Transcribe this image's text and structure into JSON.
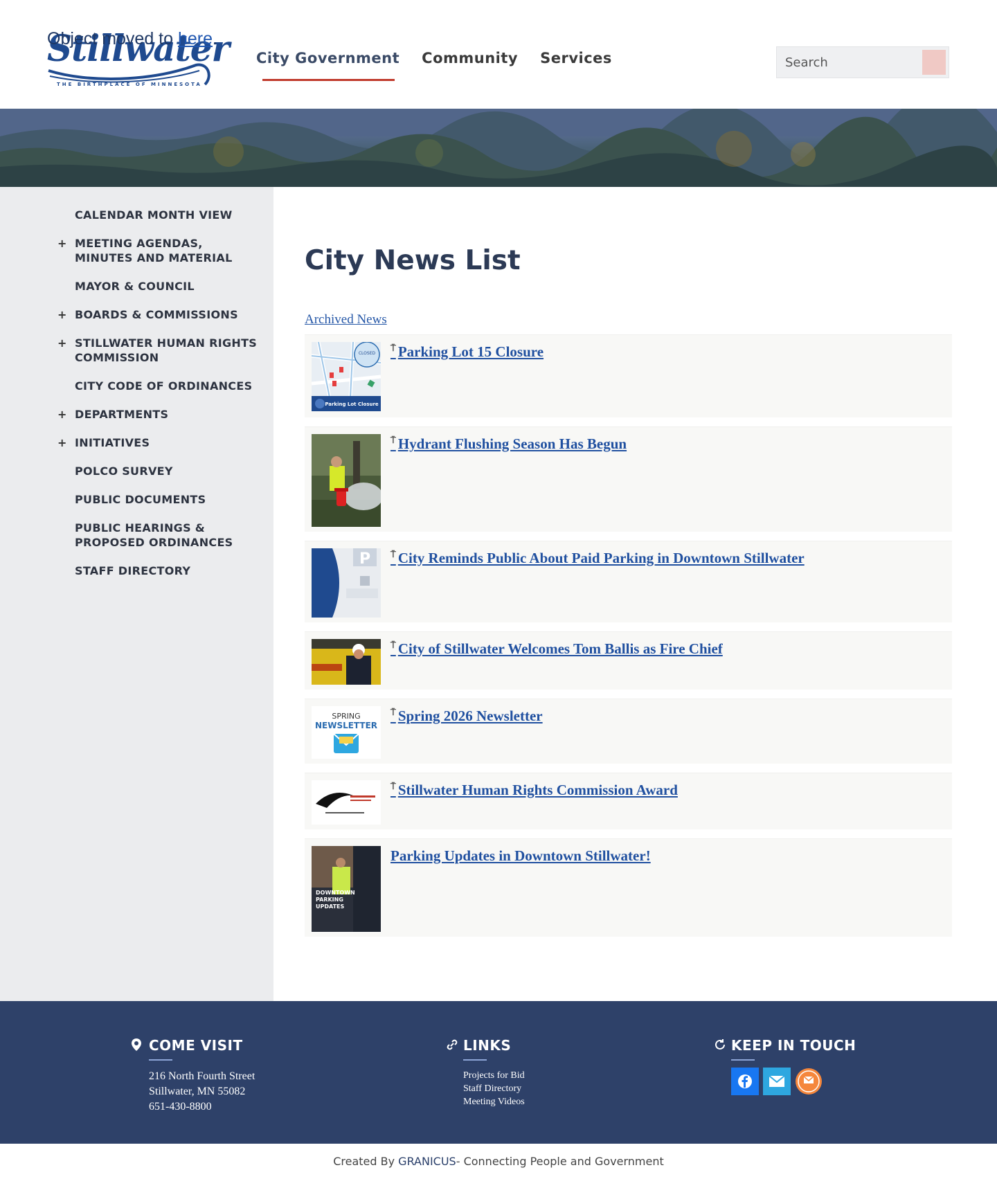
{
  "header": {
    "logo_text": "Stillwater",
    "logo_tagline": "THE BIRTHPLACE OF MINNESOTA",
    "moved_prefix": "Object moved to ",
    "moved_link": "here",
    "moved_suffix": ".",
    "nav": [
      "City Government",
      "Community",
      "Services"
    ],
    "search_placeholder": "Search"
  },
  "sidebar": {
    "items": [
      {
        "label": "CALENDAR MONTH VIEW",
        "expandable": false
      },
      {
        "label": "MEETING AGENDAS, MINUTES AND MATERIAL",
        "expandable": true
      },
      {
        "label": "MAYOR & COUNCIL",
        "expandable": false
      },
      {
        "label": "BOARDS & COMMISSIONS",
        "expandable": true
      },
      {
        "label": "STILLWATER HUMAN RIGHTS COMMISSION",
        "expandable": true
      },
      {
        "label": "CITY CODE OF ORDINANCES",
        "expandable": false
      },
      {
        "label": "DEPARTMENTS",
        "expandable": true
      },
      {
        "label": "INITIATIVES",
        "expandable": true
      },
      {
        "label": "POLCO SURVEY",
        "expandable": false
      },
      {
        "label": "PUBLIC DOCUMENTS",
        "expandable": false
      },
      {
        "label": "PUBLIC HEARINGS & PROPOSED ORDINANCES",
        "expandable": false
      },
      {
        "label": "STAFF DIRECTORY",
        "expandable": false
      }
    ],
    "plus_symbol": "+"
  },
  "main": {
    "title": "City News List",
    "archived_link": "Archived News",
    "news": [
      {
        "title": "Parking Lot 15 Closure",
        "pinned": true,
        "thumb_caption": "Parking Lot Closure",
        "thumb_badge": "CLOSED"
      },
      {
        "title": "Hydrant Flushing Season Has Begun",
        "pinned": true
      },
      {
        "title": "City Reminds Public About Paid Parking in Downtown Stillwater",
        "pinned": true
      },
      {
        "title": "City of Stillwater Welcomes Tom Ballis as Fire Chief",
        "pinned": true
      },
      {
        "title": "Spring 2026 Newsletter",
        "pinned": true,
        "thumb_line1": "SPRING",
        "thumb_line2": "NEWSLETTER"
      },
      {
        "title": "Stillwater Human Rights Commission Award",
        "pinned": true
      },
      {
        "title": "Parking Updates in Downtown Stillwater!",
        "pinned": false,
        "thumb_caption": "DOWNTOWN PARKING UPDATES"
      }
    ],
    "pin_symbol": "📍"
  },
  "footer": {
    "visit": {
      "heading": "COME VISIT",
      "address1": "216 North Fourth Street",
      "address2": "Stillwater, MN 55082",
      "phone": "651-430-8800"
    },
    "links": {
      "heading": "LINKS",
      "items": [
        "Projects for Bid",
        "Staff Directory",
        "Meeting Videos"
      ]
    },
    "touch": {
      "heading": "KEEP IN TOUCH"
    },
    "credits_prefix": "Created By ",
    "credits_brand": "GRANICUS",
    "credits_suffix": " - Connecting People and Government"
  },
  "colors": {
    "nav_active_underline": "#c0392b",
    "footer_bg": "#2e4169",
    "link_blue": "#2050a0",
    "facebook": "#1877f2",
    "email": "#2ea7e0",
    "notify": "#f5873c"
  }
}
